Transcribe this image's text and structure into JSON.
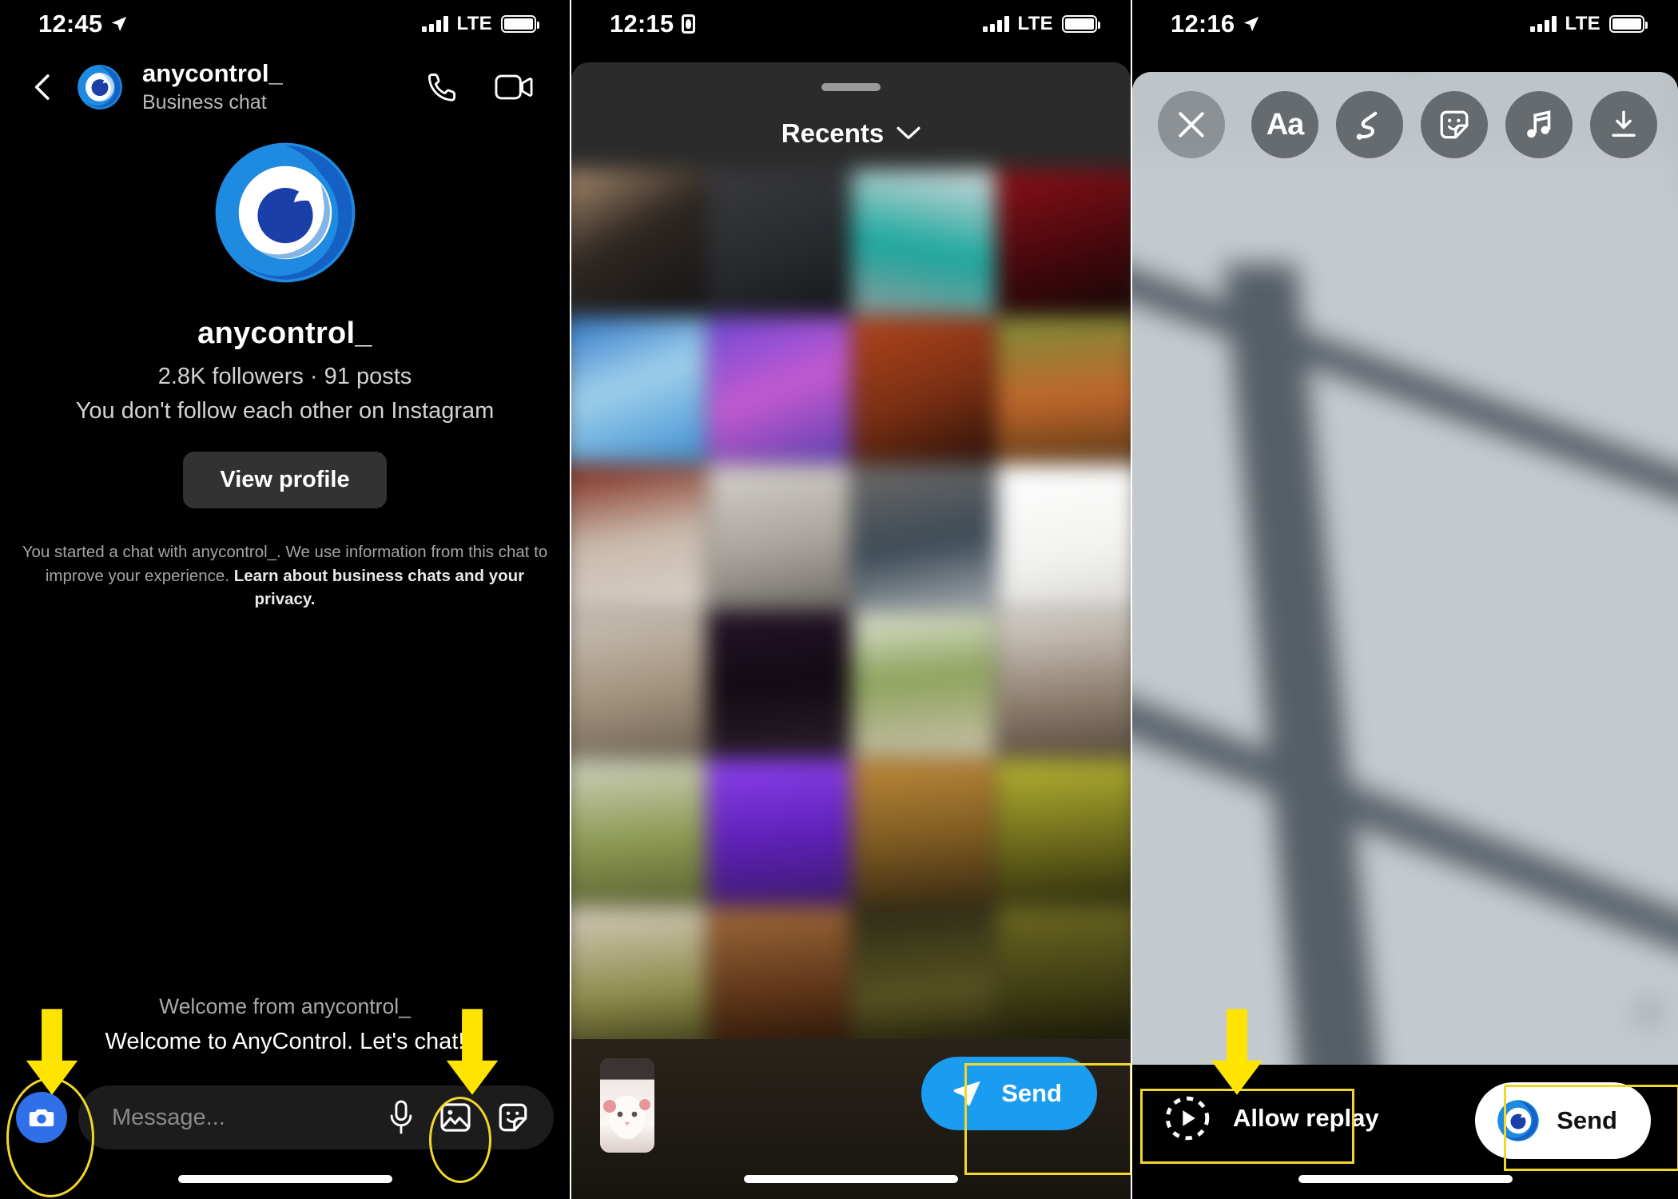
{
  "panels": {
    "chat": {
      "status": {
        "time": "12:45",
        "location_icon": "location-arrow-icon",
        "network": "LTE"
      },
      "header": {
        "back_icon": "back-chevron-icon",
        "avatar_icon": "anycontrol-logo-avatar",
        "name": "anycontrol_",
        "subtitle": "Business chat",
        "call_icon": "phone-call-icon",
        "video_icon": "video-call-icon"
      },
      "profile": {
        "avatar_icon": "anycontrol-logo-large",
        "username": "anycontrol_",
        "stats": "2.8K followers · 91 posts",
        "follow_status": "You don't follow each other on Instagram",
        "view_profile_label": "View profile",
        "disclaimer_lead": "You started a chat with anycontrol_. We use information from this chat to improve your experience. ",
        "disclaimer_link": "Learn about business chats and your privacy."
      },
      "conversation": {
        "welcome_from": "Welcome from anycontrol_",
        "welcome_message": "Welcome to AnyControl. Let's chat!"
      },
      "composer": {
        "camera_icon": "camera-icon",
        "placeholder": "Message...",
        "mic_icon": "microphone-icon",
        "gallery_icon": "photo-gallery-icon",
        "sticker_icon": "sticker-icon"
      }
    },
    "gallery": {
      "status": {
        "time": "12:15",
        "record_icon": "screen-record-icon",
        "network": "LTE"
      },
      "sheet": {
        "grabber_icon": "drag-handle-icon",
        "title": "Recents",
        "chevron_icon": "chevron-down-icon"
      },
      "footer": {
        "thumbnail_icon": "selected-photo-thumbnail",
        "send_label": "Send",
        "send_icon": "paper-plane-icon"
      }
    },
    "editor": {
      "status": {
        "time": "12:16",
        "location_icon": "location-arrow-icon",
        "network": "LTE"
      },
      "toolbar": {
        "close_icon": "close-x-icon",
        "tools": [
          {
            "name": "text-tool",
            "icon": "text-aa-icon",
            "label": "Aa"
          },
          {
            "name": "draw-tool",
            "icon": "squiggle-draw-icon",
            "label": ""
          },
          {
            "name": "sticker-tool",
            "icon": "sticker-smiley-icon",
            "label": ""
          },
          {
            "name": "music-tool",
            "icon": "music-note-icon",
            "label": ""
          },
          {
            "name": "save-tool",
            "icon": "download-arrow-icon",
            "label": ""
          }
        ]
      },
      "footer": {
        "allow_replay_label": "Allow replay",
        "allow_replay_icon": "dashed-circle-play-icon",
        "send_label": "Send",
        "send_icon": "anycontrol-logo-small"
      }
    }
  },
  "annotations": {
    "highlight_color": "#f2d72b",
    "arrow_color": "#ffe400",
    "items": [
      {
        "name": "camera-button-callout",
        "panel": "chat"
      },
      {
        "name": "gallery-icon-callout",
        "panel": "chat"
      },
      {
        "name": "send-button-callout",
        "panel": "gallery"
      },
      {
        "name": "allow-replay-callout",
        "panel": "editor"
      },
      {
        "name": "send-button-callout",
        "panel": "editor"
      }
    ]
  },
  "colors": {
    "brand_blue": "#1e8ae0",
    "brand_blue_dark": "#1a3fa8",
    "send_blue": "#1a9cf0",
    "camera_blue": "#2f6fe8",
    "background": "#000000"
  }
}
